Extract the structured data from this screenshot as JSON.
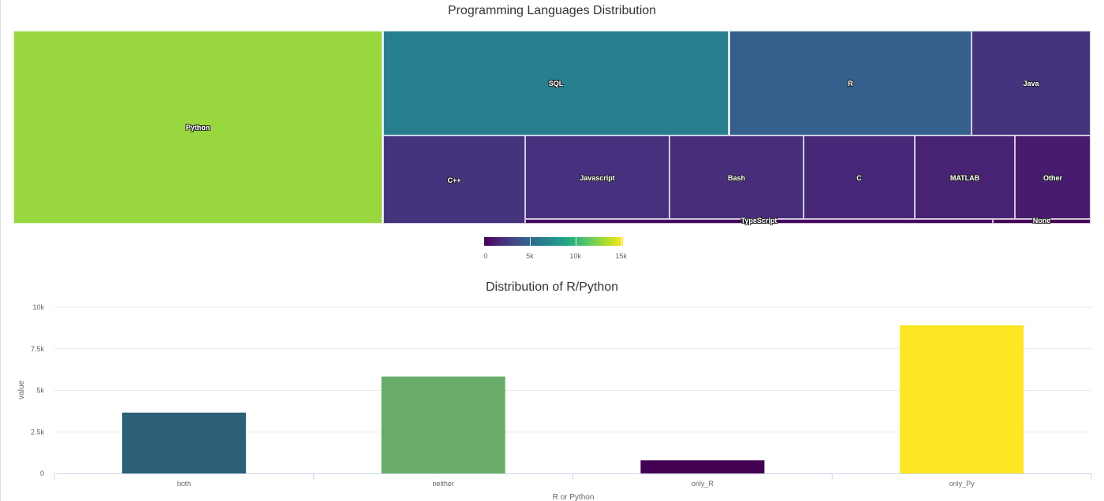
{
  "chart_data": [
    {
      "type": "treemap",
      "title": "Programming Languages Distribution",
      "items": [
        {
          "label": "Python",
          "value": 12841
        },
        {
          "label": "SQL",
          "value": 6525
        },
        {
          "label": "R",
          "value": 4558
        },
        {
          "label": "Java",
          "value": 2249
        },
        {
          "label": "C++",
          "value": 2245
        },
        {
          "label": "Javascript",
          "value": 2161
        },
        {
          "label": "Bash",
          "value": 2006
        },
        {
          "label": "C",
          "value": 1662
        },
        {
          "label": "MATLAB",
          "value": 1496
        },
        {
          "label": "Other",
          "value": 1140
        },
        {
          "label": "TypeScript",
          "value": 398
        },
        {
          "label": "None",
          "value": 83
        }
      ],
      "color_scale": {
        "name": "viridis",
        "range": [
          0,
          15200
        ],
        "ticks": [
          {
            "value": 0,
            "label": "0"
          },
          {
            "value": 5000,
            "label": "5k"
          },
          {
            "value": 10000,
            "label": "10k"
          },
          {
            "value": 15000,
            "label": "15k"
          }
        ],
        "legend_position": "bottom-center"
      }
    },
    {
      "type": "bar",
      "title": "Distribution of R/Python",
      "xlabel": "R or Python",
      "ylabel": "value",
      "categories": [
        "both",
        "neither",
        "only_R",
        "only_Py"
      ],
      "values": [
        3660,
        5830,
        790,
        8910
      ],
      "colors": [
        "#2c5f78",
        "#6aad6b",
        "#440154",
        "#fde725"
      ],
      "ylim": [
        0,
        10000
      ],
      "yticks": [
        {
          "value": 0,
          "label": "0"
        },
        {
          "value": 2500,
          "label": "2.5k"
        },
        {
          "value": 5000,
          "label": "5k"
        },
        {
          "value": 7500,
          "label": "7.5k"
        },
        {
          "value": 10000,
          "label": "10k"
        }
      ],
      "grid": true
    }
  ],
  "titles": {
    "treemap": "Programming Languages Distribution",
    "bar": "Distribution of R/Python"
  }
}
